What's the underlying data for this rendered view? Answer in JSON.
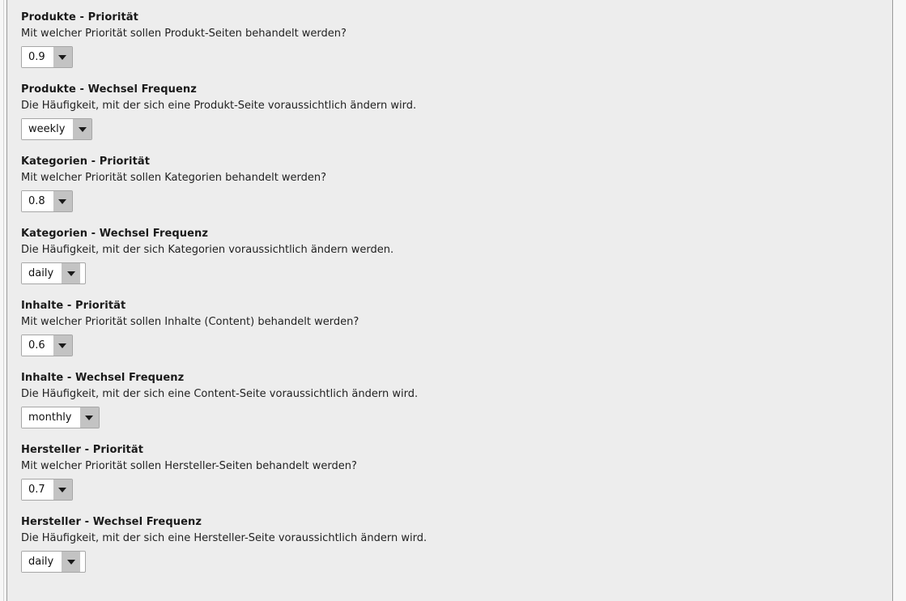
{
  "page": {
    "background_color": "#ededed",
    "outer_background_color": "#f7f7f7",
    "border_color": "#9a9a9a"
  },
  "form": {
    "groups": [
      {
        "title": "Produkte - Priorität",
        "description": "Mit welcher Priorität sollen Produkt-Seiten behandelt werden?",
        "control": {
          "type": "select",
          "name": "produkte-prioritaet",
          "value": "0.9",
          "arrow_icon": "chevron-down-icon"
        }
      },
      {
        "title": "Produkte - Wechsel Frequenz",
        "description": "Die Häufigkeit, mit der sich eine Produkt-Seite voraussichtlich ändern wird.",
        "control": {
          "type": "select",
          "name": "produkte-wechsel-frequenz",
          "value": "weekly",
          "arrow_icon": "chevron-down-icon"
        }
      },
      {
        "title": "Kategorien - Priorität",
        "description": "Mit welcher Priorität sollen Kategorien behandelt werden?",
        "control": {
          "type": "select",
          "name": "kategorien-prioritaet",
          "value": "0.8",
          "arrow_icon": "chevron-down-icon"
        }
      },
      {
        "title": "Kategorien - Wechsel Frequenz",
        "description": "Die Häufigkeit, mit der sich Kategorien voraussichtlich ändern werden.",
        "control": {
          "type": "select",
          "name": "kategorien-wechsel-frequenz",
          "value": "daily",
          "arrow_icon": "chevron-down-icon"
        }
      },
      {
        "title": "Inhalte - Priorität",
        "description": "Mit welcher Priorität sollen Inhalte (Content) behandelt werden?",
        "control": {
          "type": "select",
          "name": "inhalte-prioritaet",
          "value": "0.6",
          "arrow_icon": "chevron-down-icon"
        }
      },
      {
        "title": "Inhalte - Wechsel Frequenz",
        "description": "Die Häufigkeit, mit der sich eine Content-Seite voraussichtlich ändern wird.",
        "control": {
          "type": "select",
          "name": "inhalte-wechsel-frequenz",
          "value": "monthly",
          "arrow_icon": "chevron-down-icon"
        }
      },
      {
        "title": "Hersteller - Priorität",
        "description": "Mit welcher Priorität sollen Hersteller-Seiten behandelt werden?",
        "control": {
          "type": "select",
          "name": "hersteller-prioritaet",
          "value": "0.7",
          "arrow_icon": "chevron-down-icon"
        }
      },
      {
        "title": "Hersteller - Wechsel Frequenz",
        "description": "Die Häufigkeit, mit der sich eine Hersteller-Seite voraussichtlich ändern wird.",
        "control": {
          "type": "select",
          "name": "hersteller-wechsel-frequenz",
          "value": "daily",
          "arrow_icon": "chevron-down-icon"
        }
      }
    ]
  }
}
